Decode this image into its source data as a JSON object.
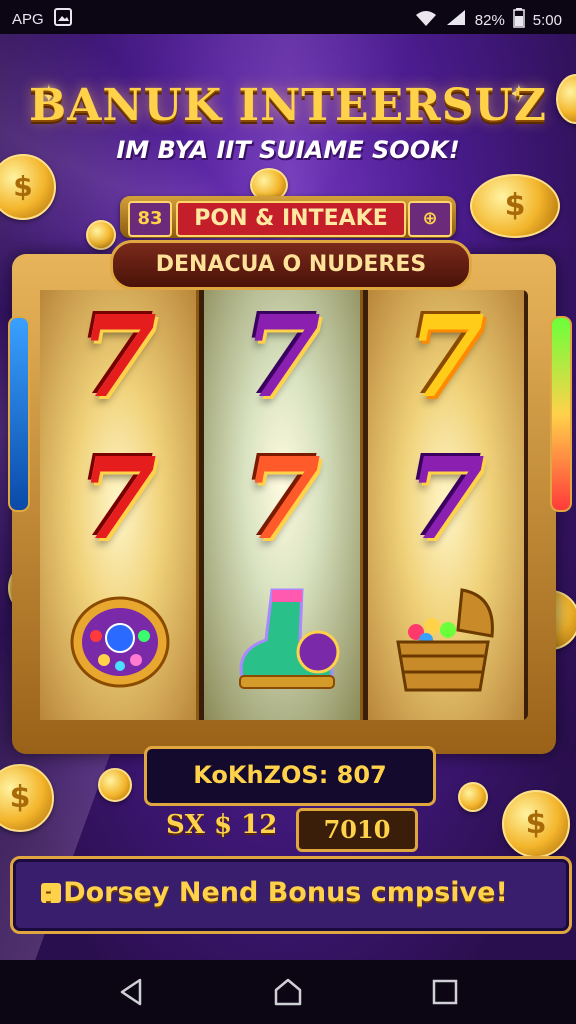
{
  "status_bar": {
    "carrier": "APG",
    "battery": "82%",
    "time": "5:00"
  },
  "game": {
    "title": "BANUK INTEERSUZ",
    "subtitle": "IM BYA IIT SUIAME SOOK!",
    "banner_top": {
      "left_cap": "83",
      "label": "PON & INTEAKE",
      "right_cap": "⊕"
    },
    "banner_sub": "DENACUA O NUDERES",
    "reels": [
      [
        "7",
        "7",
        "shield"
      ],
      [
        "7",
        "7",
        "boot"
      ],
      [
        "7",
        "7",
        "chest"
      ]
    ],
    "reel_colors": [
      [
        "red",
        "red",
        ""
      ],
      [
        "purple",
        "orange",
        ""
      ],
      [
        "gold",
        "purple",
        ""
      ]
    ],
    "bonus_readout": "KoKhZOS: 807",
    "bet_label": "SX $ 12",
    "bet_value": "7010",
    "message": ": Dorsey Nend Bonus cmpsive!"
  },
  "nav": {
    "back": "back-icon",
    "home": "home-icon",
    "recents": "recents-icon"
  },
  "colors": {
    "gold": "#ffd24a",
    "frame": "#e0a740",
    "bg_purple": "#4b1c8f",
    "banner_red": "#c41e2a"
  }
}
